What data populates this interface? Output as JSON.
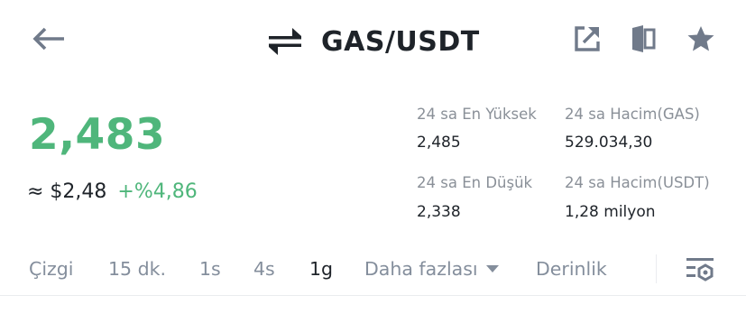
{
  "header": {
    "back_icon": "arrow-left-icon",
    "swap_icon": "swap-arrows-icon",
    "title": "GAS/USDT",
    "share_icon": "external-link-icon",
    "layout_icon": "split-view-icon",
    "favorite_icon": "star-icon"
  },
  "price": {
    "last": "2,483",
    "usd": "≈ $2,48",
    "change": "+%4,86"
  },
  "stats": {
    "high_label": "24 sa En Yüksek",
    "high_value": "2,485",
    "volume_base_label": "24 sa Hacim(GAS)",
    "volume_base_value": "529.034,30",
    "low_label": "24 sa En Düşük",
    "low_value": "2,338",
    "volume_quote_label": "24 sa Hacim(USDT)",
    "volume_quote_value": "1,28 milyon"
  },
  "tabs": {
    "line": "Çizgi",
    "m15": "15 dk.",
    "h1": "1s",
    "h4": "4s",
    "d1": "1g",
    "more": "Daha fazlası",
    "depth": "Derinlik",
    "active": "1g",
    "settings_icon": "chart-settings-icon"
  },
  "colors": {
    "up_green": "#4fb67b",
    "text_primary": "#1e2329",
    "text_secondary": "#848e9c",
    "icon_gray": "#707a8a"
  }
}
